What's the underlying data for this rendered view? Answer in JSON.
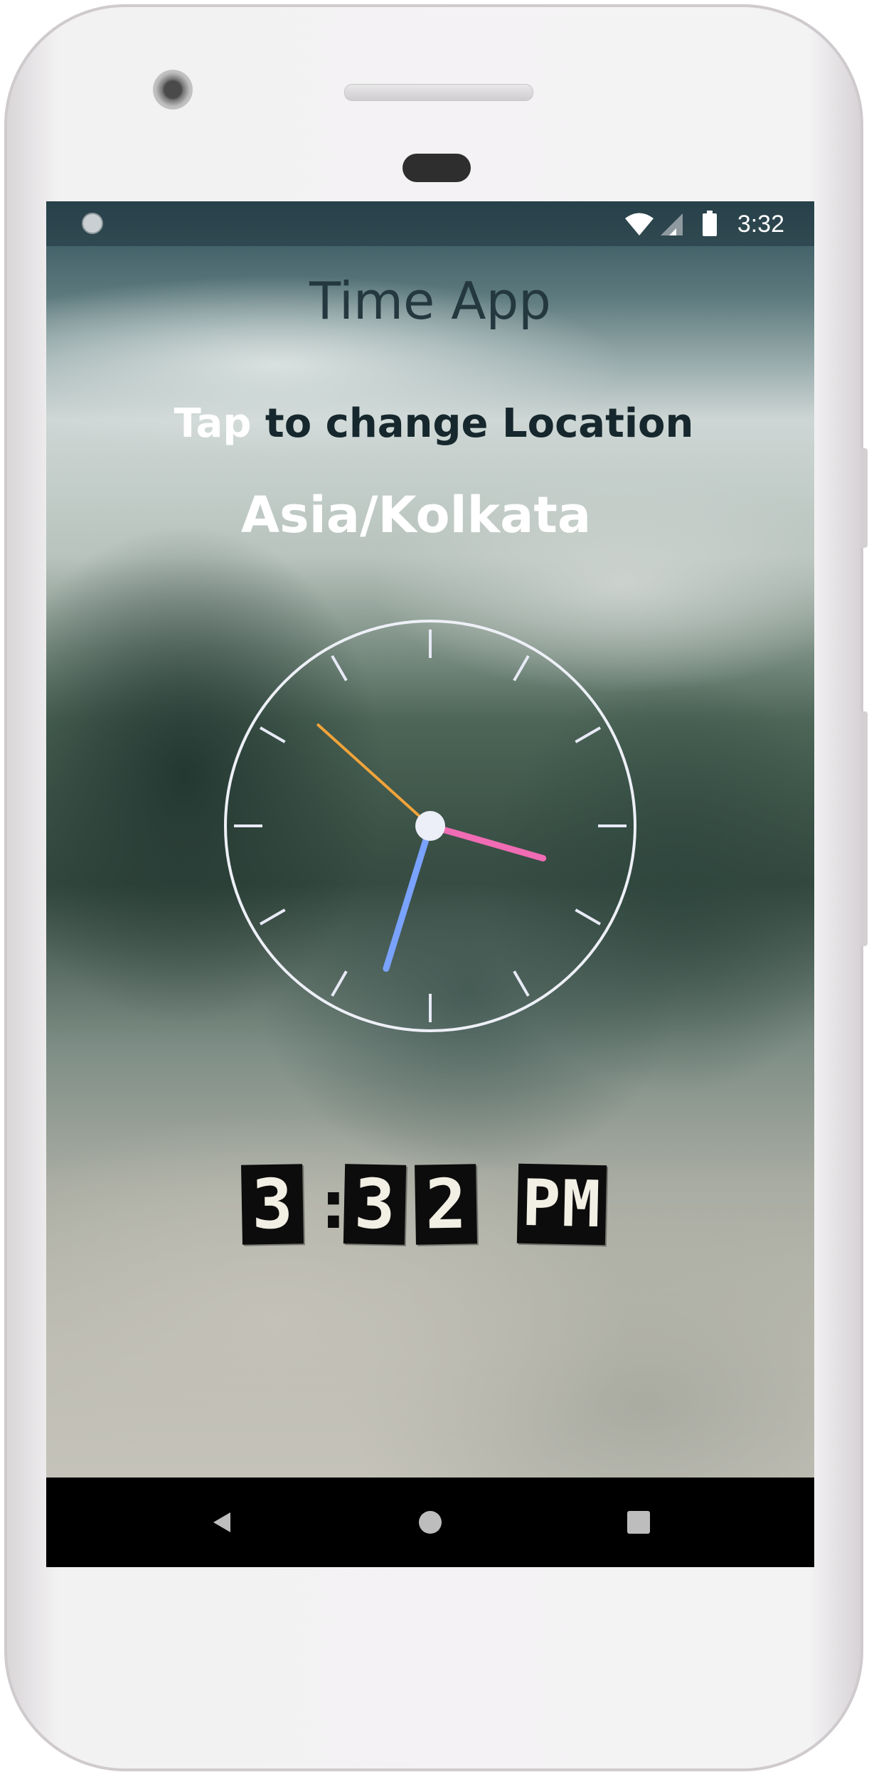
{
  "status_bar": {
    "time": "3:32",
    "icons": [
      "notification-dot-icon",
      "wifi-icon",
      "cell-signal-icon",
      "battery-icon"
    ]
  },
  "app": {
    "title": "Time App",
    "tap_prefix": "Tap",
    "tap_suffix": " to change Location",
    "location": "Asia/Kolkata"
  },
  "analog_clock": {
    "hour": 3,
    "minute": 32,
    "second": 52,
    "face_color": "#e8eaf6",
    "hour_hand_color": "#f06cb4",
    "minute_hand_color": "#7aa2ff",
    "second_hand_color": "#f2a43a"
  },
  "digital_clock": {
    "hour": "3",
    "minute_tens": "3",
    "minute_ones": "2",
    "separator": ":",
    "ampm": "PM"
  },
  "nav_bar": {
    "icons": [
      "back-icon",
      "home-icon",
      "recents-icon"
    ]
  }
}
